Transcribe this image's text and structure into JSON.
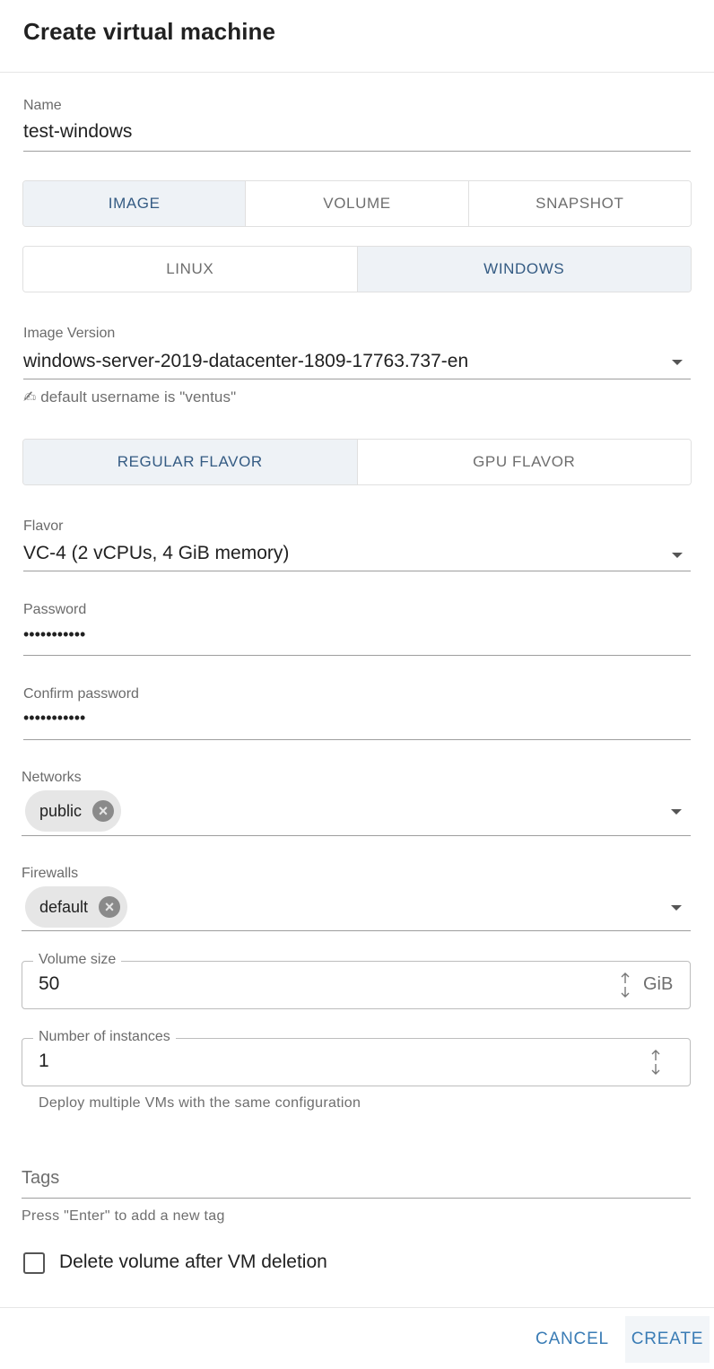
{
  "dialog": {
    "title": "Create virtual machine"
  },
  "name": {
    "label": "Name",
    "value": "test-windows"
  },
  "source_tabs": {
    "items": [
      "IMAGE",
      "VOLUME",
      "SNAPSHOT"
    ],
    "active": "IMAGE"
  },
  "os_tabs": {
    "items": [
      "LINUX",
      "WINDOWS"
    ],
    "active": "WINDOWS"
  },
  "image_version": {
    "label": "Image Version",
    "value": "windows-server-2019-datacenter-1809-17763.737-en",
    "hint_icon": "✍",
    "hint": "default username is \"ventus\""
  },
  "flavor_tabs": {
    "items": [
      "REGULAR FLAVOR",
      "GPU FLAVOR"
    ],
    "active": "REGULAR FLAVOR"
  },
  "flavor": {
    "label": "Flavor",
    "value": "VC-4 (2 vCPUs, 4 GiB memory)"
  },
  "password": {
    "label": "Password",
    "value": "•••••••••••"
  },
  "confirm_password": {
    "label": "Confirm password",
    "value": "•••••••••••"
  },
  "networks": {
    "label": "Networks",
    "chips": [
      "public"
    ]
  },
  "firewalls": {
    "label": "Firewalls",
    "chips": [
      "default"
    ]
  },
  "volume_size": {
    "label": "Volume size",
    "value": "50",
    "suffix": "GiB"
  },
  "instances": {
    "label": "Number of instances",
    "value": "1",
    "helper": "Deploy multiple VMs with the same configuration"
  },
  "tags": {
    "placeholder": "Tags",
    "helper": "Press \"Enter\" to add a new tag"
  },
  "delete_volume": {
    "label": "Delete volume after VM deletion",
    "checked": false
  },
  "actions": {
    "cancel": "CANCEL",
    "create": "CREATE"
  },
  "colors": {
    "accent": "#3a7cb5",
    "active_tab_text": "#345b83",
    "active_tab_bg": "#eef2f6"
  }
}
